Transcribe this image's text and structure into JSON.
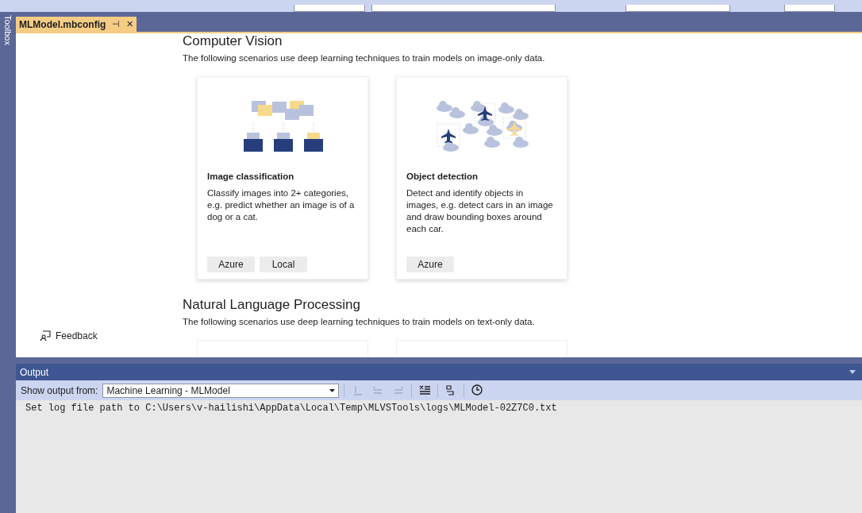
{
  "side_panel": {
    "label": "Toolbox"
  },
  "tabs": [
    {
      "label": "MLModel.mbconfig",
      "selected": true,
      "pin": "⊣",
      "close": "✕"
    }
  ],
  "sections": [
    {
      "title": "Computer Vision",
      "description": "The following scenarios use deep learning techniques to train models on image-only data.",
      "cards": [
        {
          "kind": "classification",
          "title": "Image classification",
          "description": "Classify images into 2+ categories, e.g. predict whether an image is of a dog or a cat.",
          "buttons": [
            "Azure",
            "Local"
          ]
        },
        {
          "kind": "detection",
          "title": "Object detection",
          "description": "Detect and identify objects in images, e.g. detect cars in an image and draw bounding boxes around each car.",
          "buttons": [
            "Azure"
          ]
        }
      ]
    },
    {
      "title": "Natural Language Processing",
      "description": "The following scenarios use deep learning techniques to train models on text-only data."
    }
  ],
  "feedback": {
    "label": "Feedback"
  },
  "output": {
    "title": "Output",
    "show_from_label": "Show output from:",
    "source": "Machine Learning - MLModel",
    "tools": [
      {
        "kind": "find",
        "disabled": true
      },
      {
        "kind": "prev",
        "disabled": true
      },
      {
        "kind": "next",
        "disabled": true
      },
      {
        "kind": "clear",
        "disabled": false
      },
      {
        "kind": "wrap",
        "disabled": false
      },
      {
        "kind": "clock",
        "disabled": false
      }
    ],
    "lines": [
      "Set log file path to C:\\Users\\v-hailishi\\AppData\\Local\\Temp\\MLVSTools\\logs\\MLModel-02Z7C0.txt"
    ]
  }
}
